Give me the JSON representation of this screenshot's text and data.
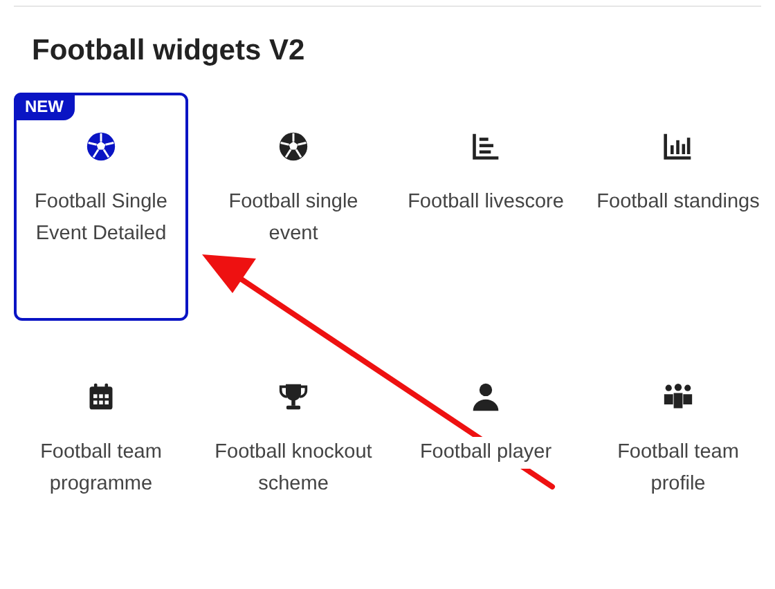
{
  "title": "Football widgets V2",
  "widgets": [
    {
      "label": "Football Single Event Detailed",
      "kind": "ball",
      "selected": true,
      "badge": "NEW"
    },
    {
      "label": "Football single event",
      "kind": "ball",
      "selected": false
    },
    {
      "label": "Football livescore",
      "kind": "list",
      "selected": false
    },
    {
      "label": "Football standings",
      "kind": "bars",
      "selected": false
    },
    {
      "label": "Football team programme",
      "kind": "calendar",
      "selected": false
    },
    {
      "label": "Football knockout scheme",
      "kind": "trophy",
      "selected": false
    },
    {
      "label": "Football player",
      "kind": "person",
      "selected": false
    },
    {
      "label": "Football team profile",
      "kind": "team",
      "selected": false
    }
  ],
  "annotation": {
    "kind": "arrow"
  }
}
